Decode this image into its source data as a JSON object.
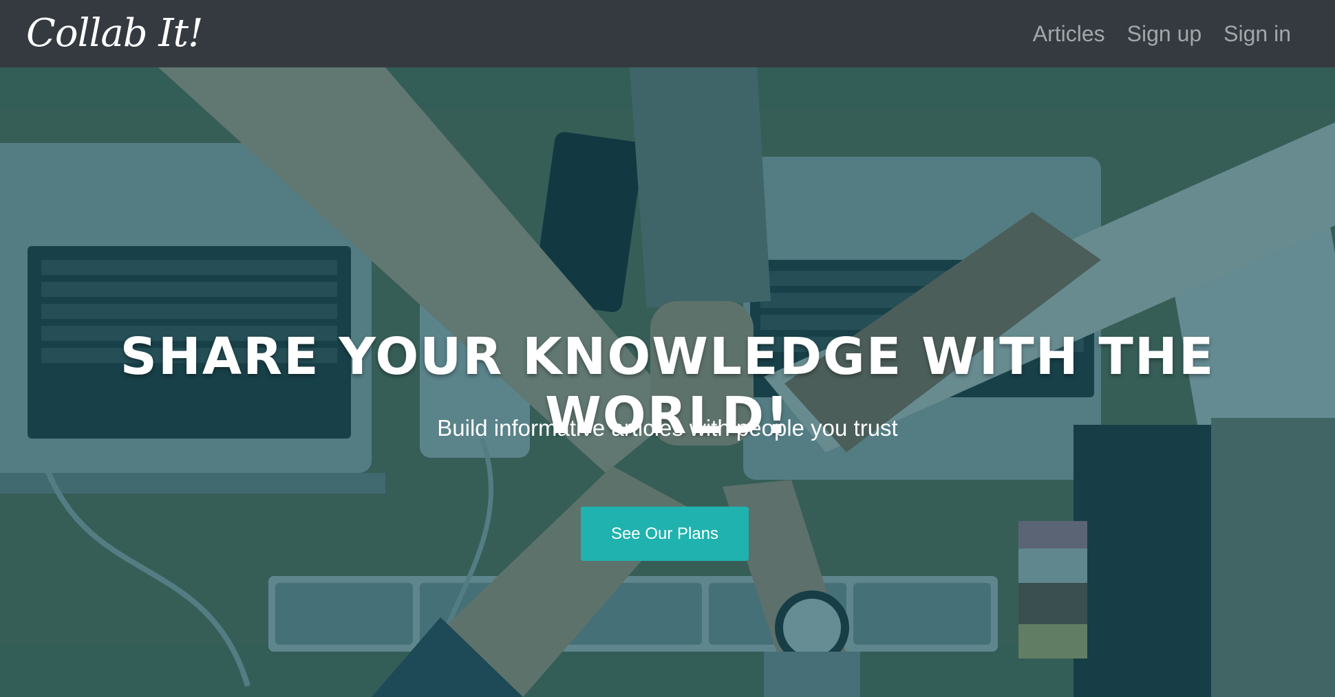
{
  "navbar": {
    "brand": "Collab It!",
    "links": [
      {
        "label": "Articles"
      },
      {
        "label": "Sign up"
      },
      {
        "label": "Sign in"
      }
    ]
  },
  "hero": {
    "title": "SHARE YOUR KNOWLEDGE WITH THE WORLD!",
    "subtitle": "Build informative articles with people you trust",
    "cta_label": "See Our Plans",
    "background_image": "team-fist-bump-over-desk-with-laptops",
    "overlay_color": "#0a4854"
  },
  "colors": {
    "navbar_bg": "#343a40",
    "nav_link": "#9a9da0",
    "cta_bg": "#1fb2ae",
    "text": "#ffffff"
  }
}
